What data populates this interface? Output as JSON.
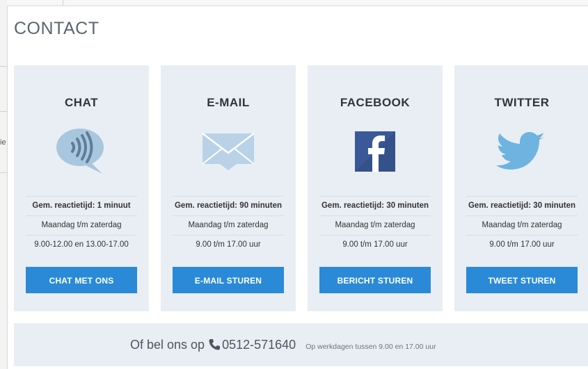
{
  "background": {
    "fragment": "ie"
  },
  "modal": {
    "title": "CONTACT"
  },
  "cards": [
    {
      "id": "chat",
      "title": "CHAT",
      "icon": "speech-bubble-icon",
      "response": "Gem. reactietijd: 1 minuut",
      "days": "Maandag t/m zaterdag",
      "hours": "9.00-12.00 en 13.00-17.00",
      "button": "CHAT MET ONS"
    },
    {
      "id": "email",
      "title": "E-MAIL",
      "icon": "envelope-icon",
      "response": "Gem. reactietijd: 90 minuten",
      "days": "Maandag t/m zaterdag",
      "hours": "9.00 t/m 17.00 uur",
      "button": "E-MAIL STUREN"
    },
    {
      "id": "facebook",
      "title": "FACEBOOK",
      "icon": "facebook-icon",
      "response": "Gem. reactietijd: 30 minuten",
      "days": "Maandag t/m zaterdag",
      "hours": "9.00 t/m 17.00 uur",
      "button": "BERICHT STUREN"
    },
    {
      "id": "twitter",
      "title": "TWITTER",
      "icon": "twitter-bird-icon",
      "response": "Gem. reactietijd: 30 minuten",
      "days": "Maandag t/m zaterdag",
      "hours": "9.00 t/m 17.00 uur",
      "button": "TWEET STUREN"
    }
  ],
  "phone": {
    "lead": "Of bel ons op",
    "icon": "phone-icon",
    "number": "0512-571640",
    "note": "Op werkdagen tussen 9.00 en 17.00 uur"
  },
  "colors": {
    "accent": "#2a8ad8",
    "card_bg": "#e9eef4",
    "icon_blue": "#a9c6df",
    "facebook": "#3b5998",
    "twitter": "#6fb3e0"
  }
}
